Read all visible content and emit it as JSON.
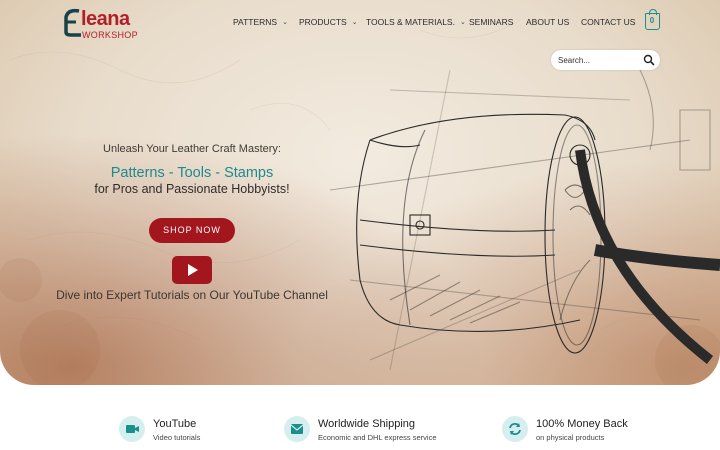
{
  "brand": {
    "name": "leana",
    "subtitle": "WORKSHOP",
    "color": "#b21f27"
  },
  "nav": {
    "items": [
      {
        "label": "PATTERNS",
        "dropdown": true
      },
      {
        "label": "PRODUCTS",
        "dropdown": true
      },
      {
        "label": "TOOLS & MATERIALS.",
        "dropdown": true
      },
      {
        "label": "SEMINARS",
        "dropdown": false
      },
      {
        "label": "ABOUT US",
        "dropdown": false
      },
      {
        "label": "CONTACT US",
        "dropdown": false
      }
    ],
    "cart_count": "0"
  },
  "search": {
    "placeholder": "Search...",
    "icon": "search-icon"
  },
  "hero": {
    "tagline": "Unleash Your Leather Craft Mastery:",
    "headline": "Patterns - Tools - Stamps",
    "subhead": "for Pros and Passionate Hobbyists!",
    "cta_label": "SHOP NOW",
    "video_caption": "Dive into Expert Tutorials on Our YouTube Channel",
    "accent_color": "#1d8a8c",
    "cta_color": "#a3161d"
  },
  "features": [
    {
      "title": "YouTube",
      "subtitle": "Video tutorials",
      "icon": "video-camera-icon"
    },
    {
      "title": "Worldwide Shipping",
      "subtitle": "Economic and DHL express service",
      "icon": "envelope-icon"
    },
    {
      "title": "100% Money Back",
      "subtitle": "on physical products",
      "icon": "refresh-icon"
    }
  ]
}
